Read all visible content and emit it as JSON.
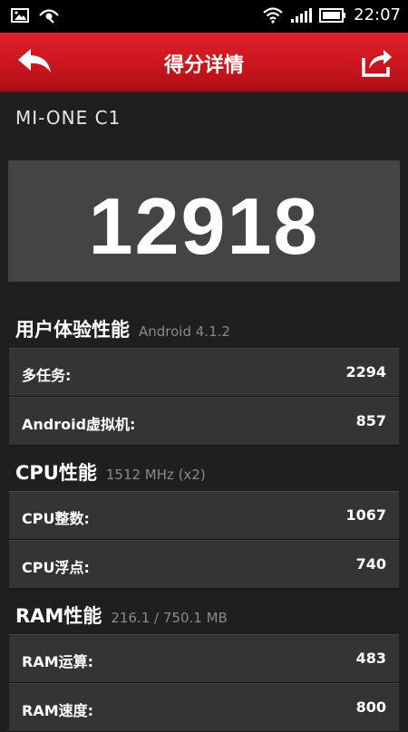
{
  "status": {
    "time": "22:07"
  },
  "header": {
    "title": "得分详情"
  },
  "device": "MI-ONE C1",
  "score": "12918",
  "sections": [
    {
      "title": "用户体验性能",
      "subtitle": "Android 4.1.2",
      "rows": [
        {
          "label": "多任务:",
          "value": "2294"
        },
        {
          "label": "Android虚拟机:",
          "value": "857"
        }
      ]
    },
    {
      "title": "CPU性能",
      "subtitle": "1512 MHz (x2)",
      "rows": [
        {
          "label": "CPU整数:",
          "value": "1067"
        },
        {
          "label": "CPU浮点:",
          "value": "740"
        }
      ]
    },
    {
      "title": "RAM性能",
      "subtitle": "216.1 / 750.1 MB",
      "rows": [
        {
          "label": "RAM运算:",
          "value": "483"
        },
        {
          "label": "RAM速度:",
          "value": "800"
        }
      ]
    }
  ],
  "icons": {
    "back": "back-arrow-icon",
    "share": "share-icon"
  }
}
